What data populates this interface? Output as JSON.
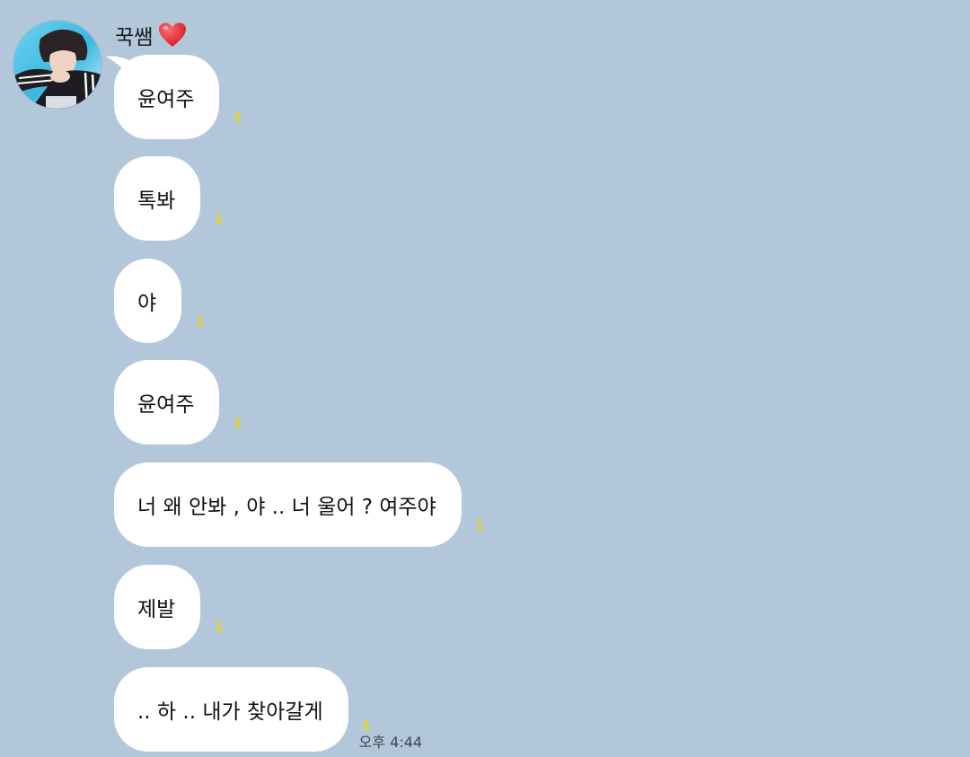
{
  "sender": {
    "name": "꾹쌤"
  },
  "messages": [
    {
      "text": "윤여주",
      "unread": "1"
    },
    {
      "text": "톡봐",
      "unread": "1"
    },
    {
      "text": "야",
      "unread": "1"
    },
    {
      "text": "윤여주",
      "unread": "1"
    },
    {
      "text": "너 왜 안봐 , 야 .. 너 울어 ? 여주야",
      "unread": "1"
    },
    {
      "text": "제발",
      "unread": "1"
    },
    {
      "text": ".. 하 .. 내가 찾아갈게",
      "unread": "1",
      "time": "오후 4:44"
    }
  ],
  "colors": {
    "background": "#b2c7da",
    "bubble": "#ffffff",
    "unread": "#e8d12a",
    "heart": "#e3262f"
  },
  "icons": {
    "heart": "heart-icon",
    "avatar": "profile-photo"
  }
}
